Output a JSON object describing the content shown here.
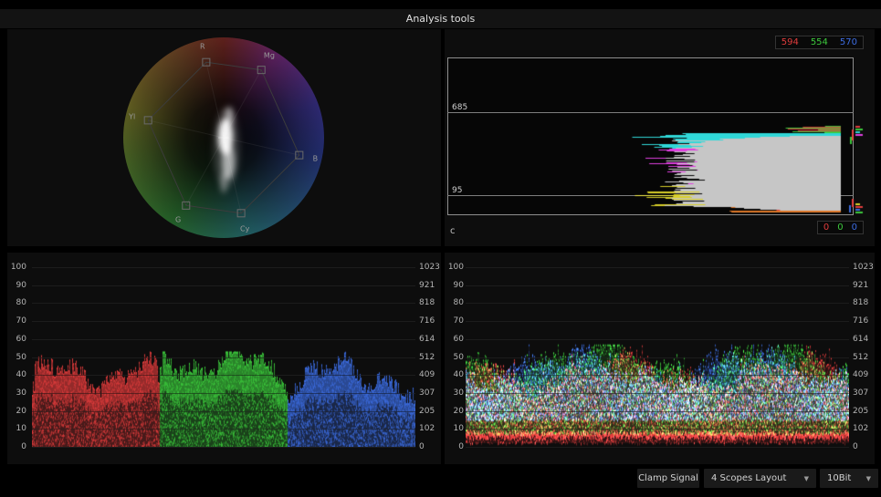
{
  "header": {
    "title": "Analysis tools"
  },
  "colors": {
    "red": "#e03c3c",
    "green": "#3cc83c",
    "blue": "#3c6ce0",
    "cyan": "#30d8d8",
    "magenta": "#e040e0",
    "yellow": "#d8d028",
    "orange": "#e07828",
    "gray_mass": "#c6c6c6"
  },
  "vectorscope": {
    "targets": [
      {
        "label": "R"
      },
      {
        "label": "Mg"
      },
      {
        "label": "B"
      },
      {
        "label": "Cy"
      },
      {
        "label": "G"
      },
      {
        "label": "Yl"
      }
    ]
  },
  "histogram": {
    "top_values": [
      {
        "value": "594",
        "channel": "red"
      },
      {
        "value": "554",
        "channel": "green"
      },
      {
        "value": "570",
        "channel": "blue"
      }
    ],
    "bottom_values": [
      {
        "value": "0",
        "channel": "red"
      },
      {
        "value": "0",
        "channel": "green"
      },
      {
        "value": "0",
        "channel": "blue"
      }
    ],
    "upper_line_label": "685",
    "lower_line_label": "95",
    "corner_label": "c"
  },
  "scales": {
    "left": [
      "100",
      "90",
      "80",
      "70",
      "60",
      "50",
      "40",
      "30",
      "20",
      "10",
      "0"
    ],
    "right": [
      "1023",
      "921",
      "818",
      "716",
      "614",
      "512",
      "409",
      "307",
      "205",
      "102",
      "0"
    ]
  },
  "footer": {
    "clamp_button": "Clamp Signal",
    "layout_dropdown": "4 Scopes Layout",
    "bit_depth_dropdown": "10Bit"
  }
}
